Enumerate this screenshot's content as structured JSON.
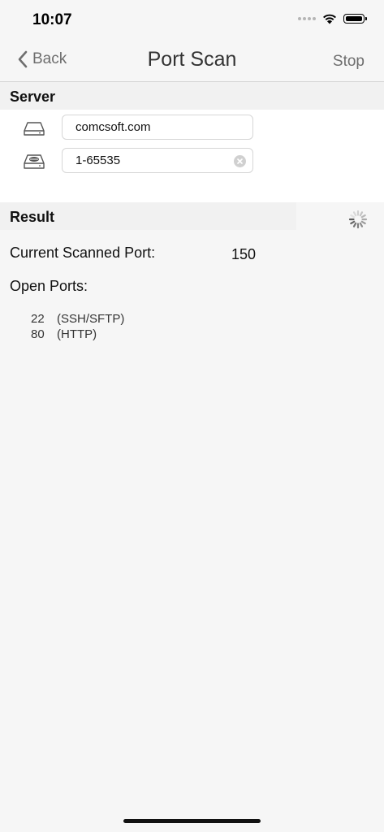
{
  "status_bar": {
    "time": "10:07"
  },
  "nav": {
    "back_label": "Back",
    "title": "Port Scan",
    "stop_label": "Stop"
  },
  "server": {
    "header": "Server",
    "host_value": "comcsoft.com",
    "port_range_value": "1-65535"
  },
  "result": {
    "header": "Result",
    "current_port_label": "Current Scanned Port:",
    "current_port_value": "150",
    "open_ports_label": "Open Ports:",
    "open_ports": [
      {
        "port": "22",
        "service": "(SSH/SFTP)"
      },
      {
        "port": "80",
        "service": "(HTTP)"
      }
    ]
  },
  "icons": {
    "host": "server-drive-icon",
    "port": "server-port-icon",
    "clear": "clear-icon",
    "spinner": "activity-spinner-icon"
  }
}
